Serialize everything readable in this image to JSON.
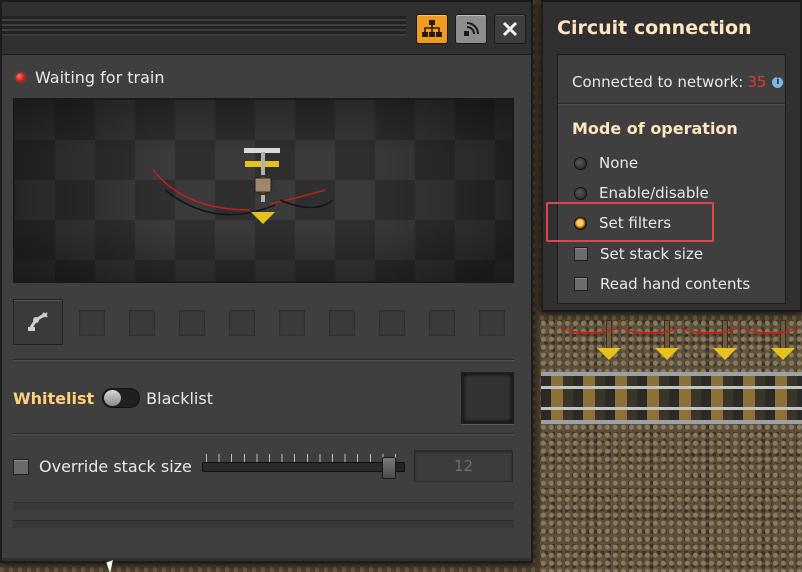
{
  "main_panel": {
    "toolbar": {
      "logistics_icon": "network-tree-icon",
      "circuit_icon": "wireless-signal-icon",
      "close_icon": "close-icon"
    },
    "status": {
      "text": "Waiting for train",
      "color": "#d41b10"
    },
    "filter": {
      "mode_active_label": "Whitelist",
      "mode_inactive_label": "Blacklist"
    },
    "override": {
      "label": "Override stack size",
      "value": "12",
      "slider_level_fraction": 0.95
    },
    "entity_icon": "inserter-icon"
  },
  "circuit_panel": {
    "title": "Circuit connection",
    "network_label": "Connected to network:",
    "network_id": "35",
    "mode_title": "Mode of operation",
    "options": [
      {
        "label": "None",
        "type": "radio",
        "selected": false
      },
      {
        "label": "Enable/disable",
        "type": "radio",
        "selected": false
      },
      {
        "label": "Set filters",
        "type": "radio",
        "selected": true
      },
      {
        "label": "Set stack size",
        "type": "checkbox",
        "checked": false
      },
      {
        "label": "Read hand contents",
        "type": "checkbox",
        "checked": false
      }
    ]
  },
  "colors": {
    "accent_orange": "#f09c1f",
    "title_text": "#ffe6c0",
    "network_number": "#e03a2a",
    "highlight_box": "#e0454a"
  }
}
